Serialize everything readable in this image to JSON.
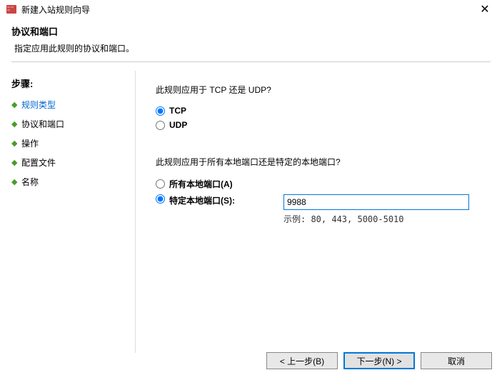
{
  "titlebar": {
    "title": "新建入站规则向导"
  },
  "header": {
    "title": "协议和端口",
    "subtitle": "指定应用此规则的协议和端口。"
  },
  "sidebar": {
    "title": "步骤:",
    "steps": [
      {
        "label": "规则类型",
        "completed": true
      },
      {
        "label": "协议和端口",
        "completed": false
      },
      {
        "label": "操作",
        "completed": false
      },
      {
        "label": "配置文件",
        "completed": false
      },
      {
        "label": "名称",
        "completed": false
      }
    ]
  },
  "main": {
    "question1": "此规则应用于 TCP 还是 UDP?",
    "protocol": {
      "tcp": "TCP",
      "udp": "UDP",
      "selected": "tcp"
    },
    "question2": "此规则应用于所有本地端口还是特定的本地端口?",
    "portOption": {
      "all": "所有本地端口(A)",
      "specific": "特定本地端口(S):",
      "selected": "specific"
    },
    "portInput": "9988",
    "example": "示例: 80, 443, 5000-5010"
  },
  "footer": {
    "back": "< 上一步(B)",
    "next": "下一步(N) >",
    "cancel": "取消"
  }
}
